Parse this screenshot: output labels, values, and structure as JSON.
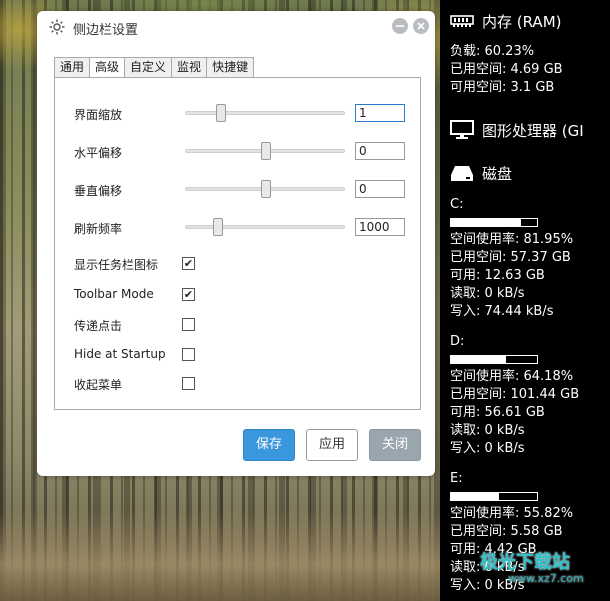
{
  "dialog": {
    "title": "侧边栏设置",
    "tabs": [
      {
        "label": "通用",
        "active": false
      },
      {
        "label": "高级",
        "active": true
      },
      {
        "label": "自定义",
        "active": false
      },
      {
        "label": "监视",
        "active": false
      },
      {
        "label": "快捷键",
        "active": false
      }
    ],
    "sliders": [
      {
        "label": "界面缩放",
        "value": "1",
        "fraction": 0.2
      },
      {
        "label": "水平偏移",
        "value": "0",
        "fraction": 0.5
      },
      {
        "label": "垂直偏移",
        "value": "0",
        "fraction": 0.5
      },
      {
        "label": "刷新频率",
        "value": "1000",
        "fraction": 0.18
      }
    ],
    "checkboxes": [
      {
        "label": "显示任务栏图标",
        "checked": true
      },
      {
        "label": "Toolbar Mode",
        "checked": true
      },
      {
        "label": "传递点击",
        "checked": false
      },
      {
        "label": "Hide at Startup",
        "checked": false
      },
      {
        "label": "收起菜单",
        "checked": false
      }
    ],
    "buttons": {
      "save": "保存",
      "apply": "应用",
      "close": "关闭"
    }
  },
  "sidebar": {
    "ram": {
      "title": "内存 (RAM)",
      "load": "负载: 60.23%",
      "used": "已用空间: 4.69 GB",
      "free": "可用空间: 3.1 GB"
    },
    "gpu": {
      "title": "图形处理器 (GI"
    },
    "disk": {
      "title": "磁盘",
      "drives": [
        {
          "name": "C:",
          "usage_pct": 81.95,
          "usage": "空间使用率: 81.95%",
          "used": "已用空间: 57.37 GB",
          "free": "可用: 12.63 GB",
          "read": "读取: 0 kB/s",
          "write": "写入: 74.44 kB/s"
        },
        {
          "name": "D:",
          "usage_pct": 64.18,
          "usage": "空间使用率: 64.18%",
          "used": "已用空间: 101.44 GB",
          "free": "可用: 56.61 GB",
          "read": "读取: 0 kB/s",
          "write": "写入: 0 kB/s"
        },
        {
          "name": "E:",
          "usage_pct": 55.82,
          "usage": "空间使用率: 55.82%",
          "used": "已用空间: 5.58 GB",
          "free": "可用: 4.42 GB",
          "read": "读取: 0 kB/s",
          "write": "写入: 0 kB/s"
        }
      ]
    }
  },
  "watermark": {
    "main": "极光下载站",
    "sub": "www.xz7.com"
  },
  "colors": {
    "accent": "#3a96dd",
    "close_button": "#9aa6ae",
    "sidebar_bg": "#000000"
  }
}
